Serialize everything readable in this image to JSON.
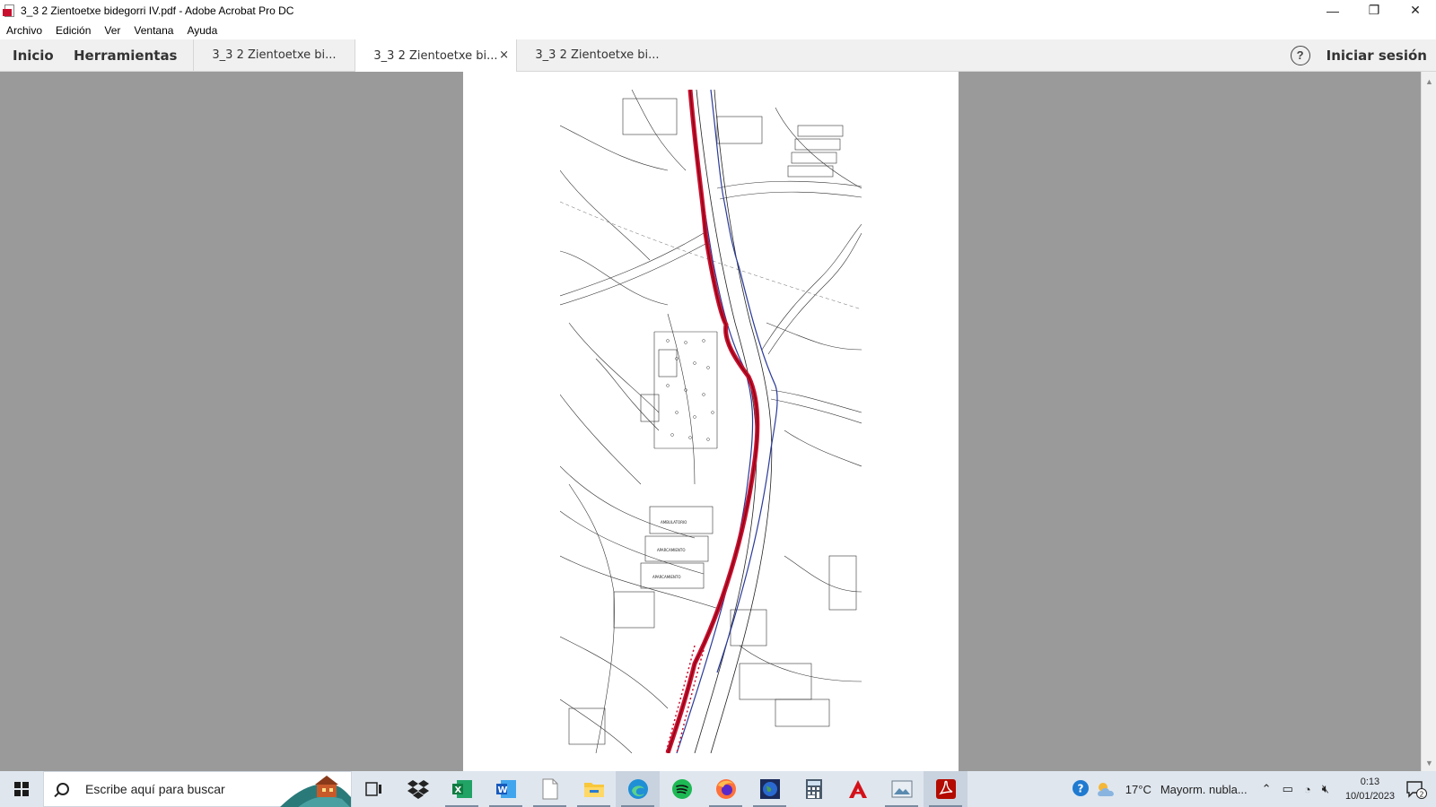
{
  "window": {
    "title": "3_3 2 Zientoetxe bidegorri IV.pdf - Adobe Acrobat Pro DC",
    "minimize_glyph": "—",
    "restore_glyph": "❐",
    "close_glyph": "✕"
  },
  "menu": {
    "items": [
      "Archivo",
      "Edición",
      "Ver",
      "Ventana",
      "Ayuda"
    ]
  },
  "toolbar": {
    "home": "Inicio",
    "tools": "Herramientas",
    "tabs": [
      {
        "label": "3_3 2 Zientoetxe bi...",
        "active": false
      },
      {
        "label": "3_3 2 Zientoetxe bi...",
        "active": true,
        "close": "×"
      },
      {
        "label": "3_3 2 Zientoetxe bi...",
        "active": false
      }
    ],
    "help": "?",
    "signin": "Iniciar sesión"
  },
  "document": {
    "map_labels": [
      "AMBULATORIO",
      "APARCAMIENTO",
      "APARCAMIENTO"
    ],
    "route_color": "#c8102e",
    "edge_color": "#2a3a9a"
  },
  "taskbar": {
    "search_placeholder": "Escribe aquí para buscar",
    "apps": [
      "task-view",
      "dropbox",
      "excel",
      "word",
      "notepad",
      "file-explorer",
      "edge",
      "spotify",
      "firefox",
      "globe-app",
      "calculator",
      "acrobat-reader",
      "photos",
      "acrobat-pro"
    ],
    "help_glyph": "?",
    "weather_temp": "17°C",
    "weather_desc": "Mayorm. nubla...",
    "time": "0:13",
    "date": "10/01/2023",
    "notifications": "2"
  }
}
